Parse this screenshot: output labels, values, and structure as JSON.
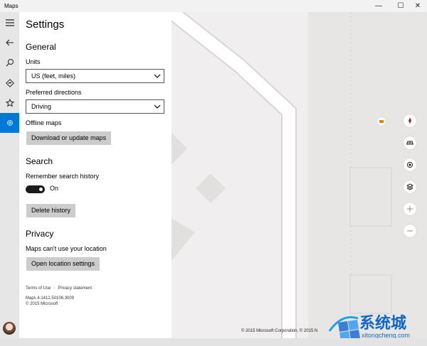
{
  "window": {
    "title": "Maps",
    "min": "—",
    "max": "☐",
    "close": "✕"
  },
  "rail": {
    "items": [
      {
        "name": "menu",
        "icon": "hamburger-icon"
      },
      {
        "name": "back",
        "icon": "back-arrow-icon"
      },
      {
        "name": "search",
        "icon": "search-icon"
      },
      {
        "name": "directions",
        "icon": "directions-icon"
      },
      {
        "name": "favorites",
        "icon": "star-icon"
      },
      {
        "name": "settings",
        "icon": "gear-icon",
        "active": true
      }
    ],
    "accent": "#0078d7"
  },
  "settings": {
    "title": "Settings",
    "general": {
      "heading": "General",
      "units_label": "Units",
      "units_value": "US (feet, miles)",
      "directions_label": "Preferred directions",
      "directions_value": "Driving",
      "offline_label": "Offline maps",
      "download_button": "Download or update maps"
    },
    "search": {
      "heading": "Search",
      "history_label": "Remember search history",
      "toggle_state": "On",
      "delete_button": "Delete history"
    },
    "privacy": {
      "heading": "Privacy",
      "location_text": "Maps can't use your location",
      "open_button": "Open location settings"
    },
    "footer": {
      "terms": "Terms of Use",
      "privacy": "Privacy statement",
      "version": "Maps 4.1412.50106.3009",
      "copyright": "© 2015 Microsoft"
    }
  },
  "map": {
    "copyright": "© 2015 Microsoft Corporation, © 2015 N",
    "controls": [
      "compass-icon",
      "3d-view-icon",
      "locate-icon",
      "layers-icon",
      "zoom-in-icon",
      "zoom-out-icon"
    ],
    "watermark_text": "系统城",
    "watermark_url": "xitongcheng.com"
  }
}
